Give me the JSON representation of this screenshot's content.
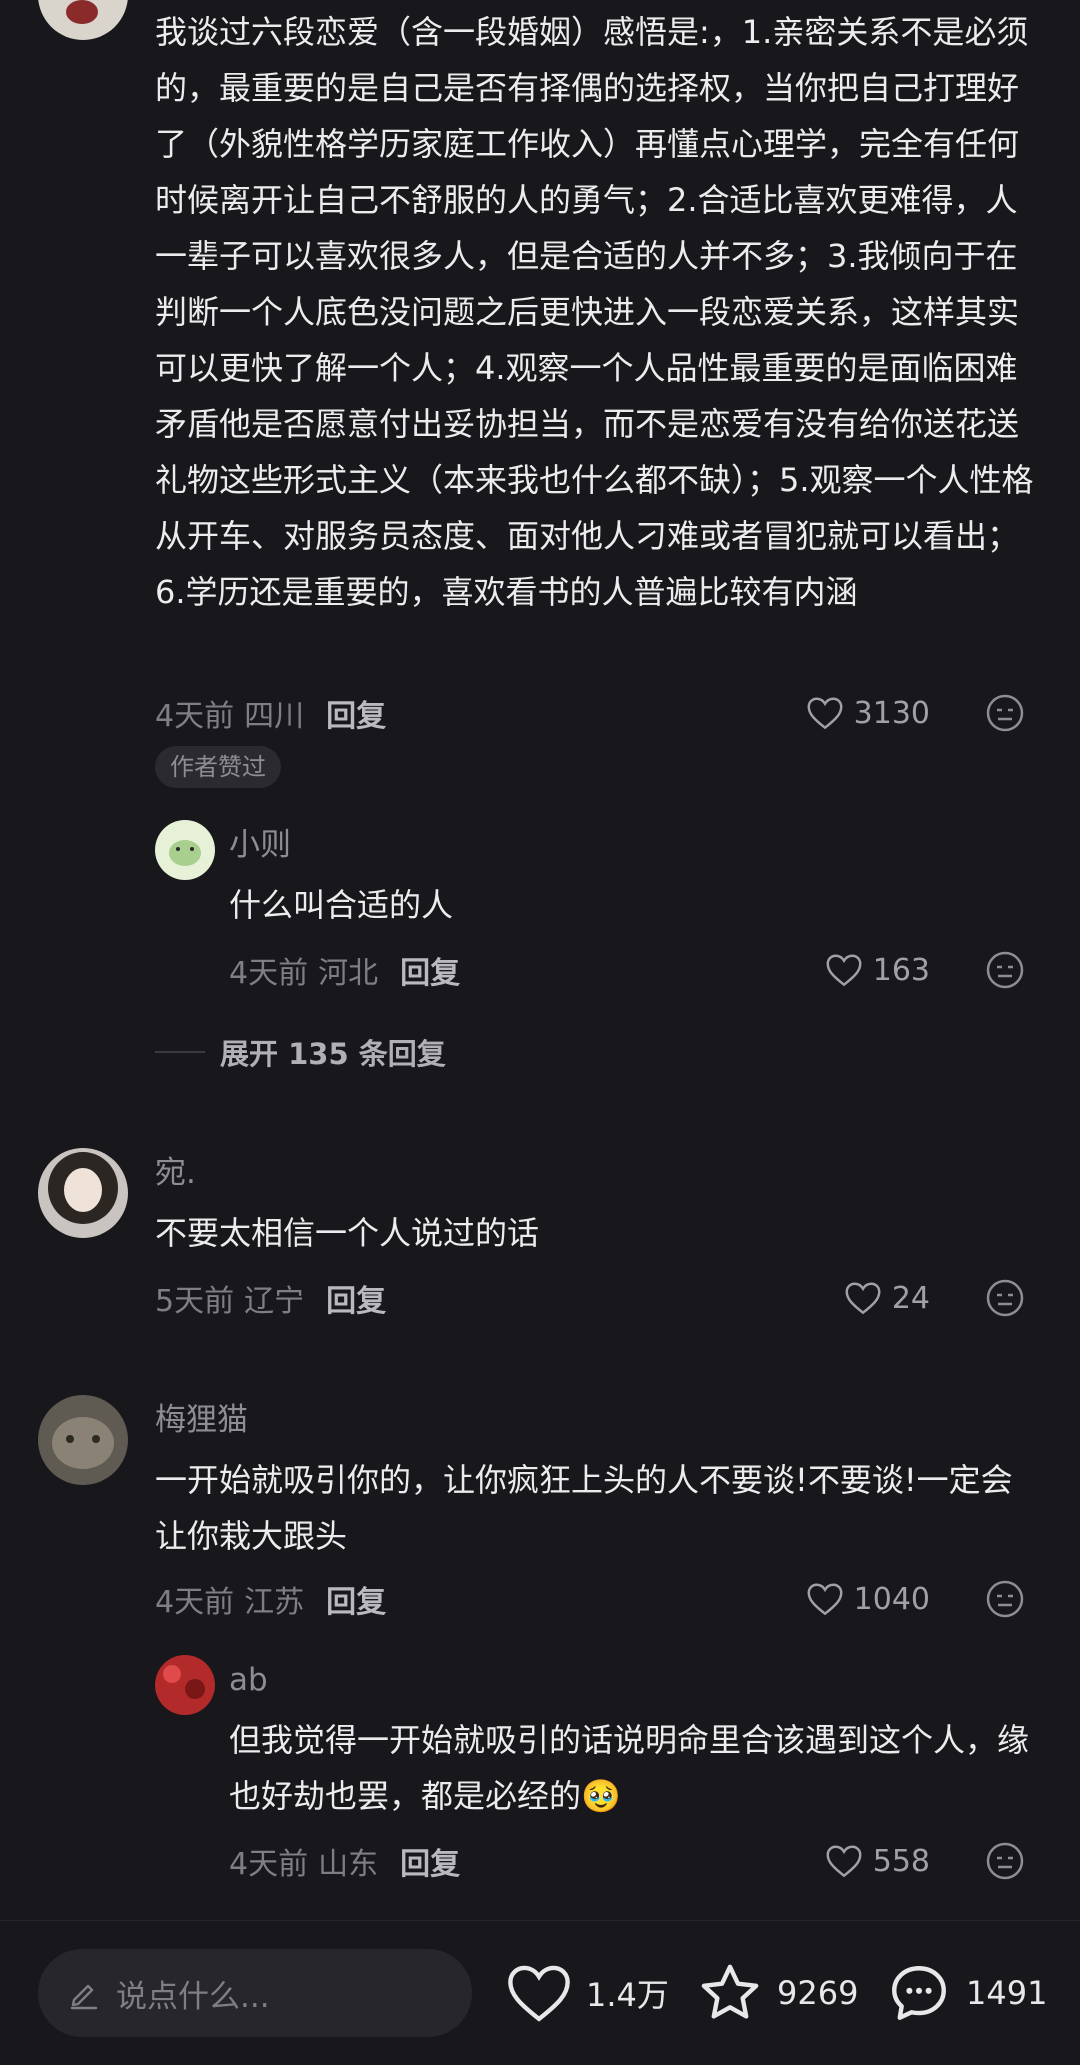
{
  "comments": [
    {
      "text": "我谈过六段恋爱（含一段婚姻）感悟是:，1.亲密关系不是必须的，最重要的是自己是否有择偶的选择权，当你把自己打理好了（外貌性格学历家庭工作收入）再懂点心理学，完全有任何时候离开让自己不舒服的人的勇气；2.合适比喜欢更难得，人一辈子可以喜欢很多人，但是合适的人并不多；3.我倾向于在判断一个人底色没问题之后更快进入一段恋爱关系，这样其实可以更快了解一个人；4.观察一个人品性最重要的是面临困难矛盾他是否愿意付出妥协担当，而不是恋爱有没有给你送花送礼物这些形式主义（本来我也什么都不缺）；5.观察一个人性格从开车、对服务员态度、面对他人刁难或者冒犯就可以看出；6.学历还是重要的，喜欢看书的人普遍比较有内涵",
      "time": "4天前",
      "location": "四川",
      "reply_label": "回复",
      "likes": "3130",
      "badge": "作者赞过",
      "replies": [
        {
          "name": "小则",
          "text": "什么叫合适的人",
          "time": "4天前",
          "location": "河北",
          "reply_label": "回复",
          "likes": "163"
        }
      ],
      "expand_label": "展开 135 条回复"
    },
    {
      "name": "宛.",
      "text": "不要太相信一个人说过的话",
      "time": "5天前",
      "location": "辽宁",
      "reply_label": "回复",
      "likes": "24"
    },
    {
      "name": "梅狸猫",
      "text": "一开始就吸引你的，让你疯狂上头的人不要谈!不要谈!一定会让你栽大跟头",
      "time": "4天前",
      "location": "江苏",
      "reply_label": "回复",
      "likes": "1040",
      "replies": [
        {
          "name": "ab",
          "text": "但我觉得一开始就吸引的话说明命里合该遇到这个人，缘也好劫也罢，都是必经的",
          "emoji": "🥹",
          "time": "4天前",
          "location": "山东",
          "reply_label": "回复",
          "likes": "558"
        }
      ]
    }
  ],
  "bottom_bar": {
    "input_placeholder": "说点什么...",
    "likes": "1.4万",
    "favorites": "9269",
    "comments": "1491"
  }
}
